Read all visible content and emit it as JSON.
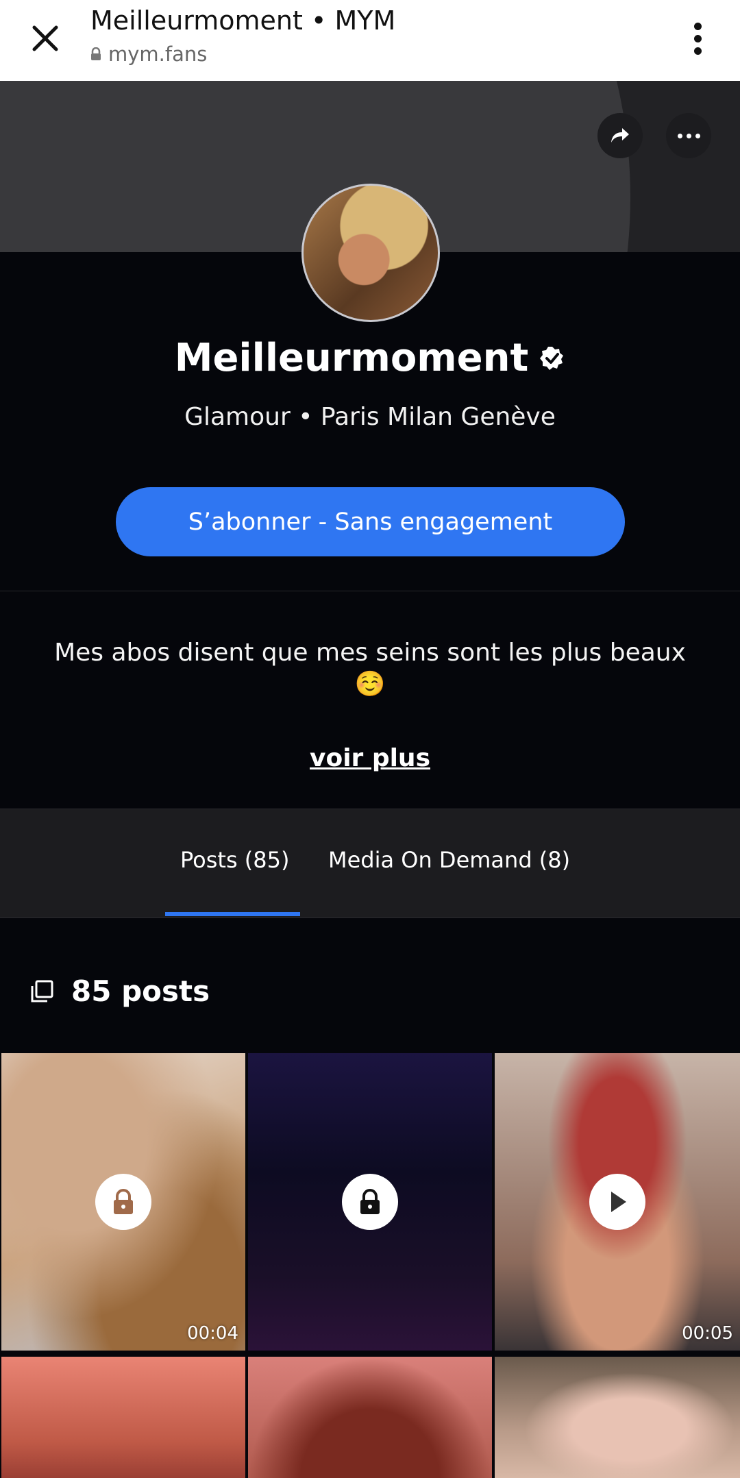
{
  "topbar": {
    "title": "Meilleurmoment • MYM",
    "url": "mym.fans"
  },
  "profile": {
    "name": "Meilleurmoment",
    "tagline": "Glamour • Paris Milan Genève",
    "subscribe_label": "S’abonner - Sans engagement",
    "bio": "Mes abos disent que mes seins sont les plus beaux ☺️",
    "see_more": "voir plus",
    "verified": true
  },
  "tabs": [
    {
      "label": "Posts (85)",
      "active": true
    },
    {
      "label": "Media On Demand (8)",
      "active": false
    }
  ],
  "posts": {
    "count_label": "85 posts",
    "items": [
      {
        "type": "locked",
        "duration": "00:04"
      },
      {
        "type": "locked",
        "duration": ""
      },
      {
        "type": "video",
        "duration": "00:05"
      },
      {
        "type": "locked",
        "duration": ""
      },
      {
        "type": "locked",
        "duration": ""
      },
      {
        "type": "image",
        "duration": ""
      }
    ]
  },
  "colors": {
    "accent": "#2f76f2",
    "background": "#05060b",
    "tab_bar": "#1c1c1f"
  }
}
